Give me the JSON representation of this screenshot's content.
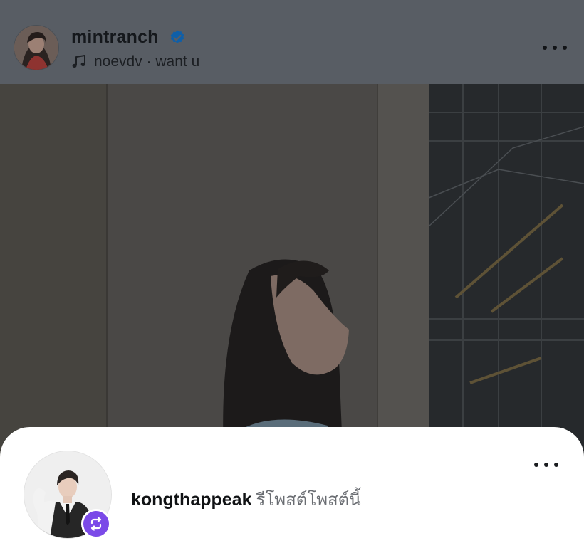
{
  "post": {
    "username": "mintranch",
    "verified": true,
    "music": "noevdv · want u",
    "more_icon": "more-horizontal-icon"
  },
  "repost": {
    "username": "kongthappeak",
    "action_text": "รีโพสต์โพสต์นี้",
    "badge_icon": "repost-icon",
    "more_icon": "more-horizontal-icon"
  },
  "colors": {
    "verified_blue": "#0f5fa8",
    "repost_badge": "#7b4ae8",
    "sheet_background": "#ffffff"
  }
}
